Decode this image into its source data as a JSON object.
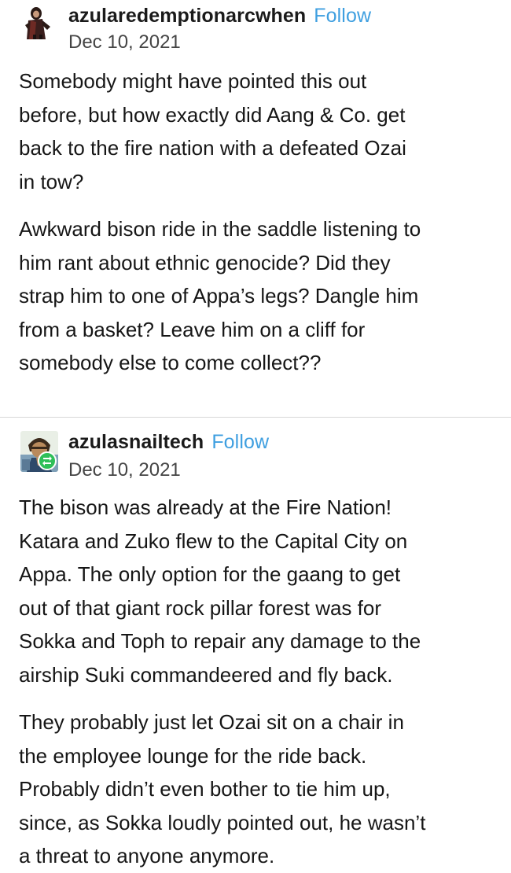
{
  "posts": [
    {
      "username": "azularedemptionarcwhen",
      "follow_label": "Follow",
      "date": "Dec 10, 2021",
      "avatar_icon": "avatar-dark-figure-icon",
      "paragraphs": [
        "Somebody might have pointed this out\nbefore, but how exactly did Aang & Co. get\nback to the fire nation with a defeated Ozai\nin tow?",
        "Awkward bison ride in the saddle listening to\nhim rant about ethnic genocide? Did they\nstrap him to one of Appa’s legs? Dangle him\nfrom a basket? Leave him on a cliff for\nsomebody else to come collect??"
      ]
    },
    {
      "username": "azulasnailtech",
      "follow_label": "Follow",
      "date": "Dec 10, 2021",
      "avatar_icon": "avatar-cartoon-character-icon",
      "badge_icon": "reblog-badge-icon",
      "paragraphs": [
        "The bison was already at the Fire Nation!\nKatara and Zuko flew to the Capital City on\nAppa. The only option for the gaang to get\nout of that giant rock pillar forest was for\nSokka and Toph to repair any damage to the\nairship Suki commandeered and fly back.",
        "They probably just let Ozai sit on a chair in\nthe employee lounge for the ride back.\nProbably didn’t even bother to tie him up,\nsince, as Sokka loudly pointed out, he wasn’t\na threat to anyone anymore."
      ]
    }
  ],
  "colors": {
    "follow": "#3f9fe0",
    "divider": "#d8d8d8",
    "badge": "#2fbf59"
  }
}
